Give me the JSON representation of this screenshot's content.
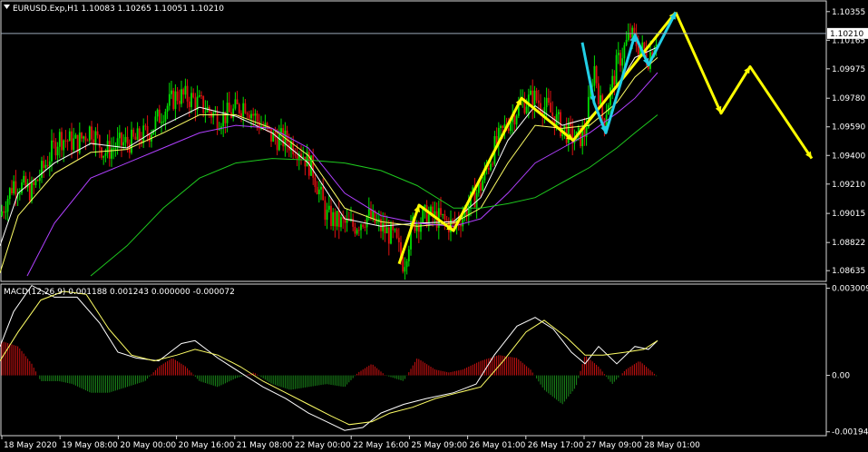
{
  "main_title": "EURUSD.Exp,H1  1.10083 1.10265 1.10051 1.10210",
  "collapse_icon": "triangle-down-icon",
  "current_price": "1.10210",
  "colors": {
    "background": "#000000",
    "bull": "#00e000",
    "bear": "#dd1111",
    "ma_fast": "#ffffff",
    "ma_mid": "#ffff66",
    "ma_slow": "#b040ff",
    "ma_long": "#1ec81e",
    "wave": "#ffff00",
    "wave_alt": "#22cfe6",
    "macd_line": "#ffffff",
    "signal_line": "#ffff66",
    "hist_pos": "#cc1111",
    "hist_neg": "#1a8a1a"
  },
  "price_ticks": [
    "1.10355",
    "1.10165",
    "1.09975",
    "1.09780",
    "1.09590",
    "1.09400",
    "1.09210",
    "1.09015",
    "1.08822",
    "1.08635"
  ],
  "macd_header": "MACD(12,26,9) 0.001188 0.001243 0.000000 -0.000072",
  "macd_ticks": [
    "0.003009",
    "0.00",
    "-0.001948"
  ],
  "time_ticks": [
    "18 May 2020",
    "19 May 08:00",
    "20 May 00:00",
    "20 May 16:00",
    "21 May 08:00",
    "22 May 00:00",
    "22 May 16:00",
    "25 May 09:00",
    "26 May 01:00",
    "26 May 17:00",
    "27 May 09:00",
    "28 May 01:00"
  ],
  "chart_data": [
    {
      "type": "candlestick",
      "symbol": "EURUSD.Exp",
      "timeframe": "H1",
      "ylim": [
        1.0857,
        1.1042
      ],
      "last_price": 1.1021,
      "close_path": [
        [
          0,
          1.09
        ],
        [
          15,
          1.0922
        ],
        [
          35,
          1.0916
        ],
        [
          50,
          1.0934
        ],
        [
          65,
          1.0952
        ],
        [
          85,
          1.0948
        ],
        [
          100,
          1.0958
        ],
        [
          115,
          1.0942
        ],
        [
          130,
          1.0947
        ],
        [
          150,
          1.095
        ],
        [
          165,
          1.0956
        ],
        [
          180,
          1.097
        ],
        [
          195,
          1.098
        ],
        [
          210,
          1.0978
        ],
        [
          225,
          1.0972
        ],
        [
          240,
          1.0965
        ],
        [
          255,
          1.0968
        ],
        [
          270,
          1.0975
        ],
        [
          285,
          1.0962
        ],
        [
          300,
          1.0952
        ],
        [
          315,
          1.095
        ],
        [
          330,
          1.0945
        ],
        [
          345,
          1.093
        ],
        [
          360,
          1.09
        ],
        [
          375,
          1.0895
        ],
        [
          390,
          1.0893
        ],
        [
          405,
          1.09
        ],
        [
          420,
          1.0892
        ],
        [
          435,
          1.0885
        ],
        [
          445,
          1.0868
        ],
        [
          455,
          1.0895
        ],
        [
          470,
          1.09
        ],
        [
          485,
          1.0898
        ],
        [
          500,
          1.0893
        ],
        [
          515,
          1.0905
        ],
        [
          530,
          1.092
        ],
        [
          545,
          1.0945
        ],
        [
          560,
          1.0962
        ],
        [
          575,
          1.0975
        ],
        [
          590,
          1.0978
        ],
        [
          605,
          1.097
        ],
        [
          620,
          1.0958
        ],
        [
          635,
          1.095
        ],
        [
          645,
          1.0955
        ],
        [
          655,
          1.1
        ],
        [
          665,
          1.0962
        ],
        [
          680,
          1.1
        ],
        [
          695,
          1.102
        ],
        [
          705,
          1.1012
        ],
        [
          715,
          1.1005
        ],
        [
          725,
          1.1021
        ]
      ],
      "moving_averages": [
        {
          "id": "ma_fast",
          "points": [
            [
              0,
              1.088
            ],
            [
              20,
              1.0915
            ],
            [
              60,
              1.0935
            ],
            [
              100,
              1.0948
            ],
            [
              140,
              1.0945
            ],
            [
              180,
              1.096
            ],
            [
              220,
              1.0972
            ],
            [
              260,
              1.0966
            ],
            [
              300,
              1.0955
            ],
            [
              340,
              1.0935
            ],
            [
              380,
              1.0898
            ],
            [
              420,
              1.0893
            ],
            [
              460,
              1.0895
            ],
            [
              500,
              1.0896
            ],
            [
              530,
              1.0912
            ],
            [
              560,
              1.095
            ],
            [
              590,
              1.0973
            ],
            [
              620,
              1.096
            ],
            [
              650,
              1.0965
            ],
            [
              680,
              1.0985
            ],
            [
              700,
              1.1005
            ],
            [
              725,
              1.1012
            ]
          ]
        },
        {
          "id": "ma_mid",
          "points": [
            [
              0,
              1.0862
            ],
            [
              20,
              1.09
            ],
            [
              60,
              1.0928
            ],
            [
              100,
              1.0942
            ],
            [
              140,
              1.0944
            ],
            [
              180,
              1.0955
            ],
            [
              220,
              1.0967
            ],
            [
              260,
              1.0967
            ],
            [
              300,
              1.0958
            ],
            [
              340,
              1.094
            ],
            [
              380,
              1.0905
            ],
            [
              420,
              1.0896
            ],
            [
              460,
              1.0893
            ],
            [
              500,
              1.0895
            ],
            [
              530,
              1.0905
            ],
            [
              560,
              1.0935
            ],
            [
              590,
              1.096
            ],
            [
              620,
              1.0958
            ],
            [
              650,
              1.096
            ],
            [
              680,
              1.0975
            ],
            [
              700,
              1.0992
            ],
            [
              725,
              1.1005
            ]
          ]
        },
        {
          "id": "ma_slow",
          "points": [
            [
              30,
              1.086
            ],
            [
              60,
              1.0895
            ],
            [
              100,
              1.0925
            ],
            [
              140,
              1.0935
            ],
            [
              180,
              1.0945
            ],
            [
              220,
              1.0955
            ],
            [
              260,
              1.096
            ],
            [
              300,
              1.0958
            ],
            [
              340,
              1.0945
            ],
            [
              380,
              1.0915
            ],
            [
              420,
              1.09
            ],
            [
              460,
              1.0895
            ],
            [
              500,
              1.0893
            ],
            [
              530,
              1.0898
            ],
            [
              560,
              1.0915
            ],
            [
              590,
              1.0935
            ],
            [
              620,
              1.0945
            ],
            [
              650,
              1.0955
            ],
            [
              680,
              1.0968
            ],
            [
              700,
              1.0978
            ],
            [
              725,
              1.0995
            ]
          ]
        },
        {
          "id": "ma_long",
          "points": [
            [
              100,
              1.086
            ],
            [
              140,
              1.088
            ],
            [
              180,
              1.0905
            ],
            [
              220,
              1.0925
            ],
            [
              260,
              1.0935
            ],
            [
              300,
              1.0938
            ],
            [
              340,
              1.0937
            ],
            [
              380,
              1.0935
            ],
            [
              420,
              1.093
            ],
            [
              460,
              1.092
            ],
            [
              500,
              1.0905
            ],
            [
              530,
              1.0905
            ],
            [
              560,
              1.0908
            ],
            [
              590,
              1.0912
            ],
            [
              620,
              1.0922
            ],
            [
              650,
              1.0932
            ],
            [
              680,
              1.0945
            ],
            [
              700,
              1.0955
            ],
            [
              725,
              1.0967
            ]
          ]
        }
      ],
      "wave_paths": [
        {
          "id": "wave",
          "points": [
            [
              440,
              1.0868
            ],
            [
              462,
              1.0907
            ],
            [
              500,
              1.089
            ],
            [
              575,
              1.0978
            ],
            [
              632,
              1.095
            ],
            [
              745,
              1.1035
            ]
          ]
        },
        {
          "id": "wave",
          "points": [
            [
              745,
              1.1035
            ],
            [
              795,
              1.0968
            ],
            [
              827,
              1.0999
            ],
            [
              895,
              1.0938
            ]
          ]
        },
        {
          "id": "wave_alt",
          "points": [
            [
              642,
              1.1015
            ],
            [
              655,
              1.0975
            ],
            [
              668,
              1.0955
            ],
            [
              700,
              1.102
            ],
            [
              715,
              1.1
            ],
            [
              745,
              1.1035
            ]
          ]
        }
      ]
    },
    {
      "type": "macd",
      "params": "12,26,9",
      "values": {
        "macd": 0.001188,
        "signal": 0.001243,
        "hist_a": 0.0,
        "hist_b": -7.2e-05
      },
      "ylim": [
        -0.00205,
        0.00312
      ],
      "macd_line": [
        [
          0,
          0.001
        ],
        [
          15,
          0.0022
        ],
        [
          35,
          0.0031
        ],
        [
          60,
          0.0027
        ],
        [
          85,
          0.0027
        ],
        [
          110,
          0.0018
        ],
        [
          130,
          0.0008
        ],
        [
          150,
          0.0006
        ],
        [
          175,
          0.0005
        ],
        [
          200,
          0.0011
        ],
        [
          215,
          0.0012
        ],
        [
          240,
          0.0006
        ],
        [
          265,
          0.0001
        ],
        [
          290,
          -0.0004
        ],
        [
          315,
          -0.0008
        ],
        [
          340,
          -0.0013
        ],
        [
          360,
          -0.0016
        ],
        [
          380,
          -0.0019
        ],
        [
          400,
          -0.0018
        ],
        [
          420,
          -0.0013
        ],
        [
          445,
          -0.001
        ],
        [
          470,
          -0.0008
        ],
        [
          500,
          -0.0006
        ],
        [
          525,
          -0.0003
        ],
        [
          545,
          0.0007
        ],
        [
          570,
          0.0017
        ],
        [
          590,
          0.002
        ],
        [
          610,
          0.0016
        ],
        [
          630,
          0.0008
        ],
        [
          645,
          0.0004
        ],
        [
          660,
          0.001
        ],
        [
          680,
          0.0004
        ],
        [
          700,
          0.001
        ],
        [
          715,
          0.0009
        ],
        [
          725,
          0.0012
        ]
      ],
      "signal_line": [
        [
          0,
          0.0005
        ],
        [
          20,
          0.0015
        ],
        [
          45,
          0.0026
        ],
        [
          70,
          0.0029
        ],
        [
          95,
          0.0028
        ],
        [
          120,
          0.0016
        ],
        [
          145,
          0.0007
        ],
        [
          170,
          0.0005
        ],
        [
          195,
          0.0007
        ],
        [
          215,
          0.0009
        ],
        [
          240,
          0.0007
        ],
        [
          265,
          0.0003
        ],
        [
          290,
          -0.0002
        ],
        [
          315,
          -0.0006
        ],
        [
          340,
          -0.001
        ],
        [
          365,
          -0.0014
        ],
        [
          385,
          -0.0017
        ],
        [
          410,
          -0.0016
        ],
        [
          430,
          -0.0013
        ],
        [
          455,
          -0.0011
        ],
        [
          480,
          -0.0008
        ],
        [
          505,
          -0.0006
        ],
        [
          530,
          -0.0004
        ],
        [
          555,
          0.0005
        ],
        [
          580,
          0.0015
        ],
        [
          600,
          0.0019
        ],
        [
          625,
          0.0013
        ],
        [
          645,
          0.0007
        ],
        [
          665,
          0.0007
        ],
        [
          690,
          0.0008
        ],
        [
          710,
          0.0009
        ],
        [
          725,
          0.0012
        ]
      ],
      "histogram": [
        [
          0,
          0.0012
        ],
        [
          20,
          0.001
        ],
        [
          35,
          0.0004
        ],
        [
          45,
          -0.0002
        ],
        [
          65,
          -0.0002
        ],
        [
          80,
          -0.0003
        ],
        [
          100,
          -0.0006
        ],
        [
          120,
          -0.0006
        ],
        [
          140,
          -0.0004
        ],
        [
          160,
          -0.0002
        ],
        [
          175,
          0.0003
        ],
        [
          190,
          0.0006
        ],
        [
          205,
          0.0003
        ],
        [
          220,
          -0.0002
        ],
        [
          240,
          -0.0004
        ],
        [
          260,
          -0.0001
        ],
        [
          280,
          0.0001
        ],
        [
          300,
          -0.0003
        ],
        [
          320,
          -0.0005
        ],
        [
          340,
          -0.0004
        ],
        [
          360,
          -0.0003
        ],
        [
          380,
          -0.0004
        ],
        [
          395,
          0.0001
        ],
        [
          410,
          0.0004
        ],
        [
          425,
          0.0
        ],
        [
          445,
          -0.0002
        ],
        [
          460,
          0.0006
        ],
        [
          480,
          0.0002
        ],
        [
          495,
          0.0001
        ],
        [
          510,
          0.0002
        ],
        [
          530,
          0.0005
        ],
        [
          550,
          0.0007
        ],
        [
          570,
          0.0006
        ],
        [
          585,
          0.0002
        ],
        [
          600,
          -0.0005
        ],
        [
          620,
          -0.001
        ],
        [
          635,
          -0.0004
        ],
        [
          645,
          0.0007
        ],
        [
          660,
          0.0003
        ],
        [
          675,
          -0.0003
        ],
        [
          690,
          0.0002
        ],
        [
          705,
          0.0005
        ],
        [
          720,
          0.0001
        ],
        [
          725,
          -7e-05
        ]
      ]
    }
  ]
}
